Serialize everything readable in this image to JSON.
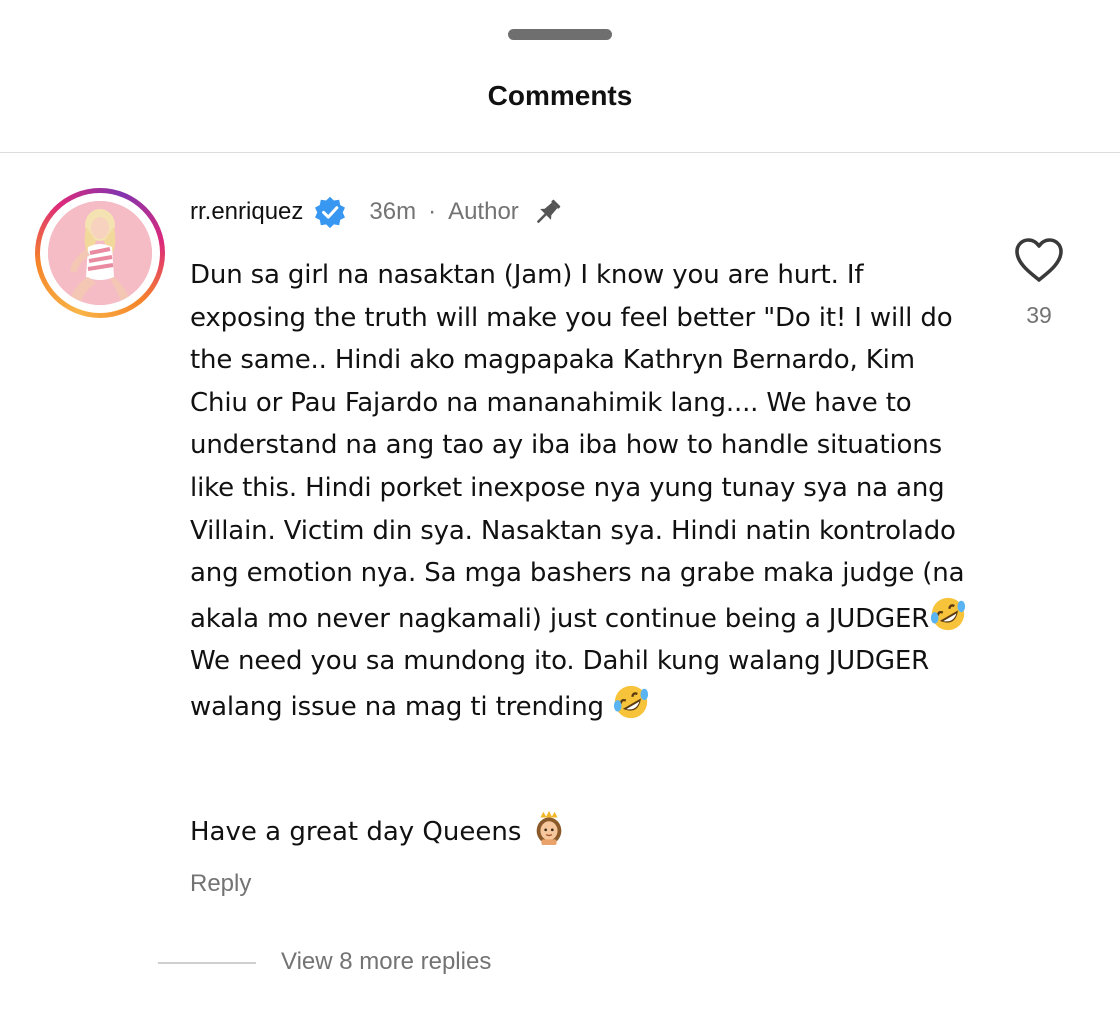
{
  "header": {
    "title": "Comments"
  },
  "comment": {
    "username": "rr.enriquez",
    "verified_icon": "verified-badge-icon",
    "time": "36m",
    "separator": "·",
    "author_label": "Author",
    "pin_icon": "pin-icon",
    "text_part1": "Dun sa girl na nasaktan (Jam) I know you are hurt. If exposing the truth will make you feel better \"Do it! I will do the same.. Hindi ako magpapaka Kathryn Bernardo, Kim Chiu or Pau Fajardo na mananahimik lang.... We have to understand na ang tao ay iba iba how to handle situations like this. Hindi porket inexpose nya yung tunay sya na ang Villain. Victim din sya. Nasaktan sya. Hindi natin kontrolado ang emotion nya. Sa mga bashers na grabe maka judge (na akala mo never nagkamali) just continue being a JUDGER",
    "text_part2": " We need you sa mundong ito. Dahil kung walang JUDGER walang issue na mag ti trending ",
    "closing": "Have a great day Queens ",
    "emoji_1": "rolling-on-floor-laughing-emoji",
    "emoji_2": "rolling-on-floor-laughing-emoji",
    "emoji_3": "princess-emoji",
    "reply_label": "Reply",
    "like_icon": "heart-icon",
    "like_count": "39",
    "view_replies": "View 8 more replies"
  },
  "colors": {
    "text": "#111111",
    "muted": "#737373",
    "verified": "#3897f0",
    "divider": "#dcdcdc"
  }
}
